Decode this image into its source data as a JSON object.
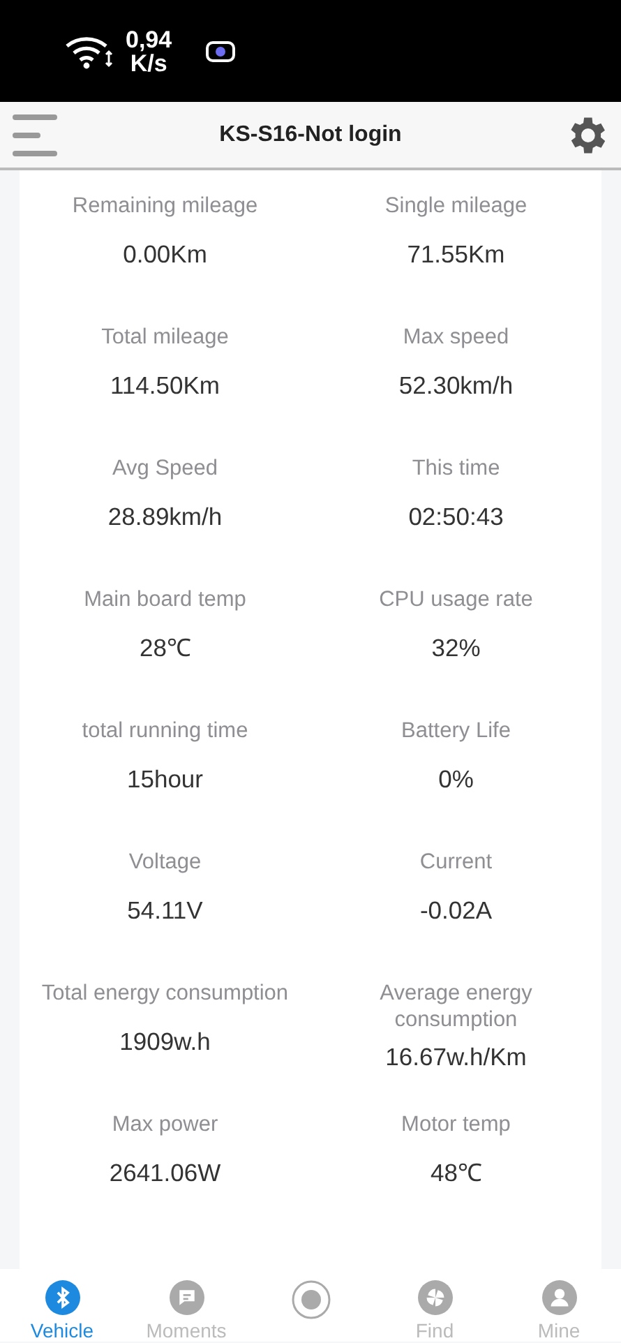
{
  "status_bar": {
    "speed_value": "0,94",
    "speed_unit": "K/s"
  },
  "header": {
    "title": "KS-S16-Not login"
  },
  "stats": [
    {
      "label": "Remaining mileage",
      "value": "0.00Km"
    },
    {
      "label": "Single mileage",
      "value": "71.55Km"
    },
    {
      "label": "Total mileage",
      "value": "114.50Km"
    },
    {
      "label": "Max speed",
      "value": "52.30km/h"
    },
    {
      "label": "Avg Speed",
      "value": "28.89km/h"
    },
    {
      "label": "This time",
      "value": "02:50:43"
    },
    {
      "label": "Main board temp",
      "value": "28℃"
    },
    {
      "label": "CPU usage rate",
      "value": "32%"
    },
    {
      "label": "total running time",
      "value": "15hour"
    },
    {
      "label": "Battery Life",
      "value": "0%"
    },
    {
      "label": "Voltage",
      "value": "54.11V"
    },
    {
      "label": "Current",
      "value": "-0.02A"
    },
    {
      "label": "Total energy consumption",
      "value": "1909w.h"
    },
    {
      "label": "Average energy consumption",
      "value": "16.67w.h/Km"
    },
    {
      "label": "Max power",
      "value": "2641.06W"
    },
    {
      "label": "Motor temp",
      "value": "48℃"
    }
  ],
  "tabs": [
    {
      "kind": "bluetooth",
      "label": "Vehicle",
      "selected": true
    },
    {
      "kind": "chat",
      "label": "Moments",
      "selected": false
    },
    {
      "kind": "record",
      "selected": false
    },
    {
      "kind": "fan",
      "label": "Find",
      "selected": false
    },
    {
      "kind": "person",
      "label": "Mine",
      "selected": false
    }
  ]
}
